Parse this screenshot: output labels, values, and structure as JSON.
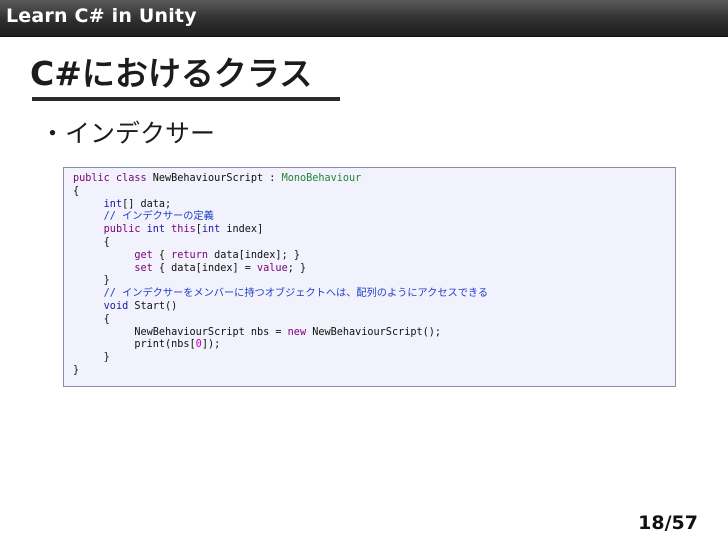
{
  "header": {
    "title": "Learn C# in Unity"
  },
  "slide": {
    "title": "C#におけるクラス",
    "bullet": "・インデクサー"
  },
  "code": [
    [
      {
        "t": "public",
        "c": "kw"
      },
      {
        "t": " "
      },
      {
        "t": "class",
        "c": "kw"
      },
      {
        "t": " NewBehaviourScript : "
      },
      {
        "t": "MonoBehaviour",
        "c": "cls"
      }
    ],
    [
      {
        "t": "{"
      }
    ],
    [
      {
        "t": "     "
      },
      {
        "t": "int",
        "c": "type"
      },
      {
        "t": "[] data;"
      }
    ],
    [
      {
        "t": "     "
      },
      {
        "t": "// インデクサーの定義",
        "c": "cm"
      }
    ],
    [
      {
        "t": "     "
      },
      {
        "t": "public",
        "c": "kw"
      },
      {
        "t": " "
      },
      {
        "t": "int",
        "c": "type"
      },
      {
        "t": " "
      },
      {
        "t": "this",
        "c": "kw"
      },
      {
        "t": "["
      },
      {
        "t": "int",
        "c": "type"
      },
      {
        "t": " index]"
      }
    ],
    [
      {
        "t": "     {"
      }
    ],
    [
      {
        "t": "          "
      },
      {
        "t": "get",
        "c": "kw"
      },
      {
        "t": " { "
      },
      {
        "t": "return",
        "c": "kw"
      },
      {
        "t": " data[index]; }"
      }
    ],
    [
      {
        "t": "          "
      },
      {
        "t": "set",
        "c": "kw"
      },
      {
        "t": " { data[index] = "
      },
      {
        "t": "value",
        "c": "kw"
      },
      {
        "t": "; }"
      }
    ],
    [
      {
        "t": "     }"
      }
    ],
    [
      {
        "t": "     "
      },
      {
        "t": "// インデクサーをメンバーに持つオブジェクトへは、配列のようにアクセスできる",
        "c": "cm"
      }
    ],
    [
      {
        "t": "     "
      },
      {
        "t": "void",
        "c": "type"
      },
      {
        "t": " Start()"
      }
    ],
    [
      {
        "t": "     {"
      }
    ],
    [
      {
        "t": "          NewBehaviourScript nbs = "
      },
      {
        "t": "new",
        "c": "kw"
      },
      {
        "t": " NewBehaviourScript();"
      }
    ],
    [
      {
        "t": "          print(nbs["
      },
      {
        "t": "0",
        "c": "num"
      },
      {
        "t": "]);"
      }
    ],
    [
      {
        "t": "     }"
      }
    ],
    [
      {
        "t": "}"
      }
    ]
  ],
  "footer": {
    "page": "18/57"
  }
}
